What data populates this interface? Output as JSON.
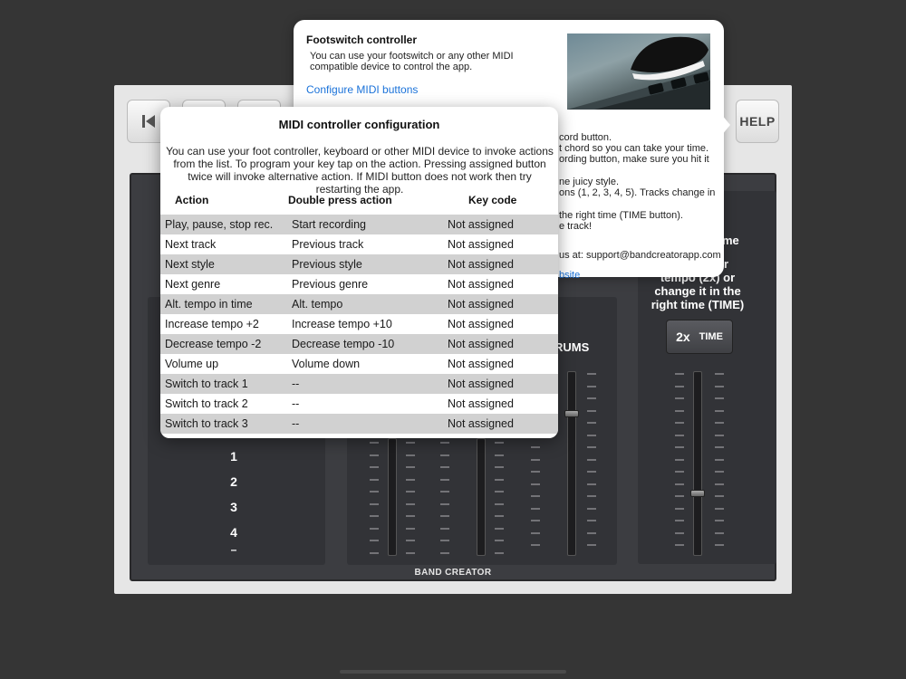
{
  "help_button": {
    "label": "HELP"
  },
  "brand": {
    "label": "BAND CREATOR"
  },
  "track_numbers": [
    "1",
    "2",
    "3",
    "4",
    "–"
  ],
  "right_panel": {
    "title_partial": "ome",
    "text_partial": [
      "ur",
      "tempo (2x) or",
      "change it in the",
      "right time (TIME)"
    ]
  },
  "tempo_buttons": {
    "double_label": "2x",
    "time_label": "TIME"
  },
  "drums_label_partial": "RUMS",
  "footswitch_popover": {
    "title": "Footswitch controller",
    "description": "You can use your footswitch or any other MIDI compatible device to control the app.",
    "configure_link": "Configure MIDI buttons",
    "help_lines": [
      "cord button.",
      "t chord so you can take your time.",
      "ording button, make sure you hit it",
      "",
      "ne juicy style.",
      "ons (1, 2, 3, 4, 5). Tracks change in",
      "",
      " the right time (TIME button).",
      "e track!",
      "",
      " us at: support@bandcreatorapp.com",
      "bsite"
    ]
  },
  "midi_modal": {
    "title": "MIDI controller configuration",
    "description": "You can use your foot controller, keyboard or other MIDI device to invoke actions from the list. To program your key tap on the action. Pressing assigned button twice will invoke alternative action. If MIDI button does not work then try restarting the app.",
    "columns": {
      "action": "Action",
      "double": "Double press action",
      "key": "Key code"
    },
    "rows": [
      {
        "action": "Play, pause, stop rec.",
        "double": "Start recording",
        "key": "Not assigned"
      },
      {
        "action": "Next track",
        "double": "Previous track",
        "key": "Not assigned"
      },
      {
        "action": "Next style",
        "double": "Previous style",
        "key": "Not assigned"
      },
      {
        "action": "Next genre",
        "double": "Previous genre",
        "key": "Not assigned"
      },
      {
        "action": "Alt. tempo in time",
        "double": "Alt. tempo",
        "key": "Not assigned"
      },
      {
        "action": "Increase tempo +2",
        "double": "Increase tempo +10",
        "key": "Not assigned"
      },
      {
        "action": "Decrease tempo -2",
        "double": "Decrease tempo -10",
        "key": "Not assigned"
      },
      {
        "action": "Volume up",
        "double": "Volume down",
        "key": "Not assigned"
      },
      {
        "action": "Switch to track 1",
        "double": "--",
        "key": "Not assigned"
      },
      {
        "action": "Switch to track 2",
        "double": "--",
        "key": "Not assigned"
      },
      {
        "action": "Switch to track 3",
        "double": "--",
        "key": "Not assigned"
      }
    ]
  }
}
